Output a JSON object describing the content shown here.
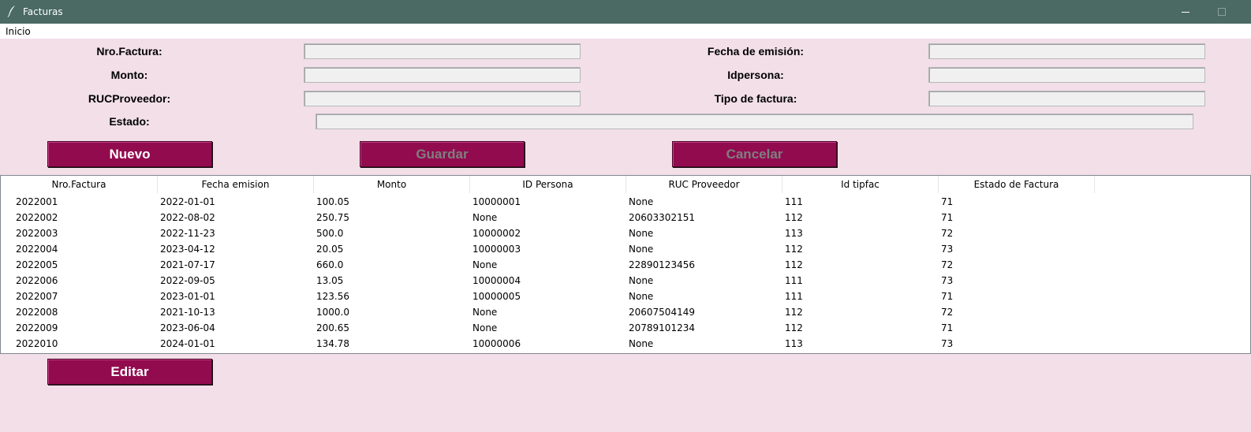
{
  "window": {
    "title": "Facturas",
    "icon": "feather-icon",
    "colors": {
      "titlebar": "#4a6a63",
      "background": "#f2dfe8",
      "button": "#920b4f"
    }
  },
  "menu": {
    "items": [
      "Inicio"
    ]
  },
  "form": {
    "nro_factura": {
      "label": "Nro.Factura:",
      "value": ""
    },
    "fecha_emision": {
      "label": "Fecha de emisión:",
      "value": ""
    },
    "monto": {
      "label": "Monto:",
      "value": ""
    },
    "idpersona": {
      "label": "Idpersona:",
      "value": ""
    },
    "ruc_proveedor": {
      "label": "RUCProveedor:",
      "value": ""
    },
    "tipo_factura": {
      "label": "Tipo de factura:",
      "value": ""
    },
    "estado": {
      "label": "Estado:",
      "value": ""
    }
  },
  "buttons": {
    "nuevo": "Nuevo",
    "guardar": "Guardar",
    "cancelar": "Cancelar",
    "editar": "Editar"
  },
  "table": {
    "columns": [
      "Nro.Factura",
      "Fecha emision",
      "Monto",
      "ID Persona",
      "RUC Proveedor",
      "Id tipfac",
      "Estado de Factura"
    ],
    "rows": [
      [
        "2022001",
        "2022-01-01",
        "100.05",
        "10000001",
        "None",
        "111",
        "71"
      ],
      [
        "2022002",
        "2022-08-02",
        "250.75",
        "None",
        "20603302151",
        "112",
        "71"
      ],
      [
        "2022003",
        "2022-11-23",
        "500.0",
        "10000002",
        "None",
        "113",
        "72"
      ],
      [
        "2022004",
        "2023-04-12",
        "20.05",
        "10000003",
        "None",
        "112",
        "73"
      ],
      [
        "2022005",
        "2021-07-17",
        "660.0",
        "None",
        "22890123456",
        "112",
        "72"
      ],
      [
        "2022006",
        "2022-09-05",
        "13.05",
        "10000004",
        "None",
        "111",
        "73"
      ],
      [
        "2022007",
        "2023-01-01",
        "123.56",
        "10000005",
        "None",
        "111",
        "71"
      ],
      [
        "2022008",
        "2021-10-13",
        "1000.0",
        "None",
        "20607504149",
        "112",
        "72"
      ],
      [
        "2022009",
        "2023-06-04",
        "200.65",
        "None",
        "20789101234",
        "112",
        "71"
      ],
      [
        "2022010",
        "2024-01-01",
        "134.78",
        "10000006",
        "None",
        "113",
        "73"
      ]
    ]
  }
}
